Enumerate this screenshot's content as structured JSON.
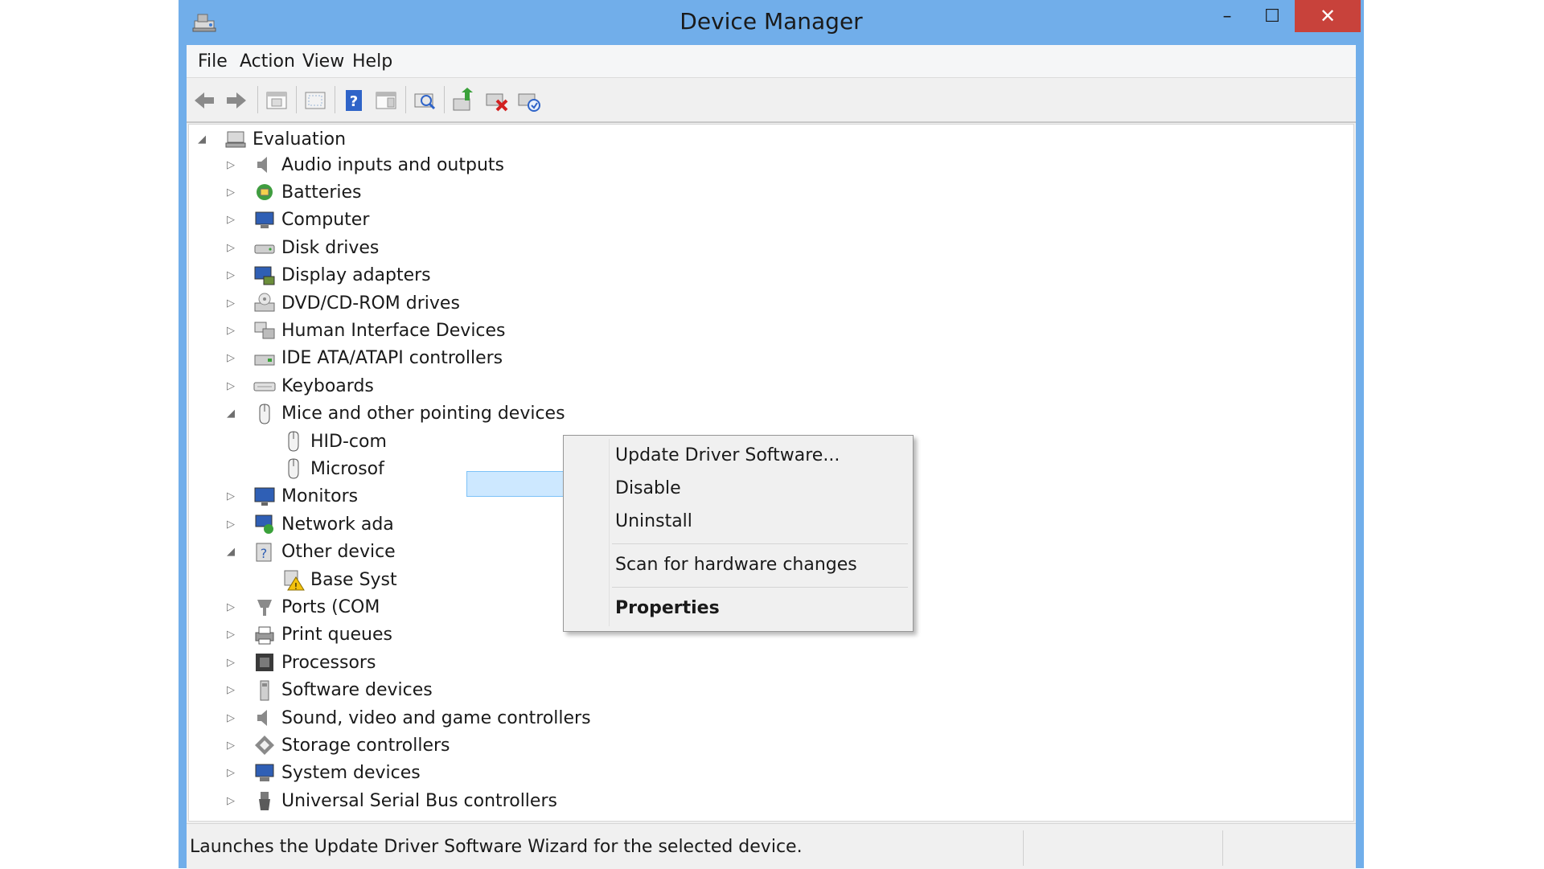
{
  "window": {
    "title": "Device Manager",
    "close_glyph": "✕",
    "min_glyph": "–",
    "max_glyph": "☐"
  },
  "menu": [
    "File",
    "Action",
    "View",
    "Help"
  ],
  "toolbar_icons": [
    "back-icon",
    "forward-icon",
    "properties-pane-icon",
    "show-hidden-icon",
    "help-icon",
    "action-pane-icon",
    "scan-hardware-icon",
    "update-driver-icon",
    "uninstall-icon",
    "enable-device-icon"
  ],
  "tree": {
    "root": "Evaluation",
    "items": [
      {
        "label": "Audio inputs and outputs",
        "expanded": false,
        "icon": "speaker-icon"
      },
      {
        "label": "Batteries",
        "expanded": false,
        "icon": "battery-icon"
      },
      {
        "label": "Computer",
        "expanded": false,
        "icon": "computer-icon"
      },
      {
        "label": "Disk drives",
        "expanded": false,
        "icon": "disk-drive-icon"
      },
      {
        "label": "Display adapters",
        "expanded": false,
        "icon": "display-adapter-icon"
      },
      {
        "label": "DVD/CD-ROM drives",
        "expanded": false,
        "icon": "optical-drive-icon"
      },
      {
        "label": "Human Interface Devices",
        "expanded": false,
        "icon": "hid-icon"
      },
      {
        "label": "IDE ATA/ATAPI controllers",
        "expanded": false,
        "icon": "ide-controller-icon"
      },
      {
        "label": "Keyboards",
        "expanded": false,
        "icon": "keyboard-icon"
      },
      {
        "label": "Mice and other pointing devices",
        "expanded": true,
        "icon": "mouse-icon"
      },
      {
        "label": "HID-com",
        "child": true,
        "selected": true,
        "icon": "mouse-icon"
      },
      {
        "label": "Microsof",
        "child": true,
        "icon": "mouse-icon"
      },
      {
        "label": "Monitors",
        "expanded": false,
        "icon": "monitor-icon"
      },
      {
        "label": "Network ada",
        "expanded": false,
        "icon": "network-adapter-icon"
      },
      {
        "label": "Other device",
        "expanded": true,
        "icon": "other-devices-icon"
      },
      {
        "label": "Base Syst",
        "child": true,
        "icon": "warning-device-icon"
      },
      {
        "label": "Ports (COM",
        "expanded": false,
        "icon": "port-icon"
      },
      {
        "label": "Print queues",
        "expanded": false,
        "icon": "printer-icon"
      },
      {
        "label": "Processors",
        "expanded": false,
        "icon": "processor-icon"
      },
      {
        "label": "Software devices",
        "expanded": false,
        "icon": "software-device-icon"
      },
      {
        "label": "Sound, video and game controllers",
        "expanded": false,
        "icon": "speaker-icon"
      },
      {
        "label": "Storage controllers",
        "expanded": false,
        "icon": "storage-controller-icon"
      },
      {
        "label": "System devices",
        "expanded": false,
        "icon": "system-devices-icon"
      },
      {
        "label": "Universal Serial Bus controllers",
        "expanded": false,
        "icon": "usb-icon"
      }
    ]
  },
  "context_menu": {
    "update_driver": "Update Driver Software...",
    "disable": "Disable",
    "uninstall": "Uninstall",
    "scan": "Scan for hardware changes",
    "properties": "Properties"
  },
  "status": {
    "text": "Launches the Update Driver Software Wizard for the selected device."
  },
  "colors": {
    "titlebar": "#71aeea",
    "close": "#c8423b",
    "selection": "#cde8ff",
    "selection_border": "#7dc2f7"
  }
}
